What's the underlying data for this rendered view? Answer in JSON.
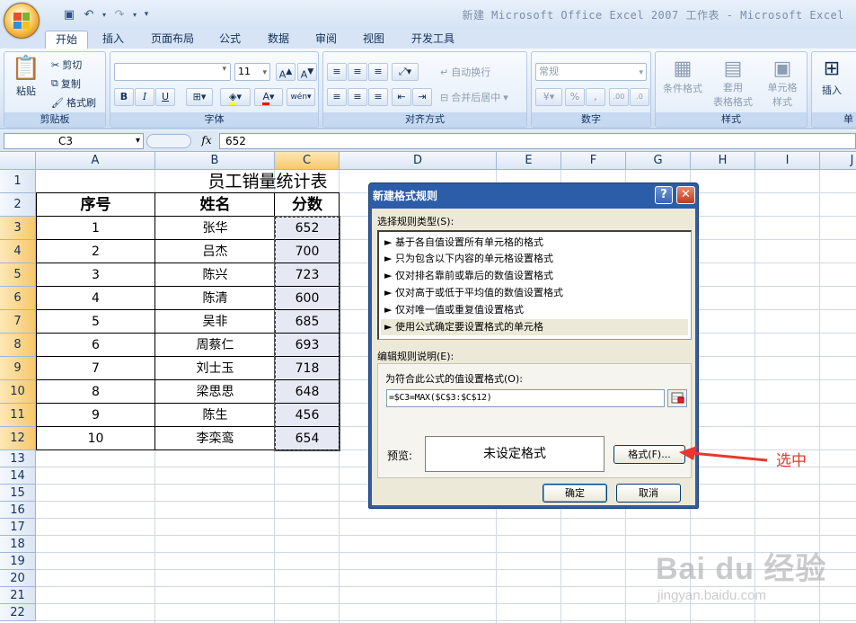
{
  "app": {
    "window_title": "新建 Microsoft Office Excel 2007 工作表 - Microsoft Excel",
    "tabs": [
      "开始",
      "插入",
      "页面布局",
      "公式",
      "数据",
      "审阅",
      "视图",
      "开发工具"
    ],
    "active_tab": "开始"
  },
  "ribbon": {
    "clipboard": {
      "paste": "粘贴",
      "cut": "剪切",
      "copy": "复制",
      "format_painter": "格式刷",
      "label": "剪贴板"
    },
    "font": {
      "size": "11",
      "bold": "B",
      "italic": "I",
      "underline": "U",
      "label": "字体"
    },
    "alignment": {
      "wrap": "自动换行",
      "merge": "合并后居中",
      "label": "对齐方式"
    },
    "number": {
      "format": "常规",
      "percent": "%",
      "comma": ",",
      "label": "数字"
    },
    "styles": {
      "conditional": "条件格式",
      "table_line1": "套用",
      "table_line2": "表格格式",
      "cell_line1": "单元格",
      "cell_line2": "样式",
      "label": "样式"
    },
    "cells": {
      "insert": "插入",
      "label": "单"
    }
  },
  "formula_bar": {
    "name_box": "C3",
    "fx": "fx",
    "value": "652"
  },
  "sheet": {
    "columns": [
      "A",
      "B",
      "C",
      "D",
      "E",
      "F",
      "G",
      "H",
      "I",
      "J"
    ],
    "rows": [
      "1",
      "2",
      "3",
      "4",
      "5",
      "6",
      "7",
      "8",
      "9",
      "10",
      "11",
      "12",
      "13",
      "14",
      "15",
      "16",
      "17",
      "18",
      "19",
      "20",
      "21",
      "22"
    ],
    "title": "员工销量统计表",
    "headers": [
      "序号",
      "姓名",
      "分数"
    ],
    "data": [
      [
        "1",
        "张华",
        "652"
      ],
      [
        "2",
        "吕杰",
        "700"
      ],
      [
        "3",
        "陈兴",
        "723"
      ],
      [
        "4",
        "陈清",
        "600"
      ],
      [
        "5",
        "吴非",
        "685"
      ],
      [
        "6",
        "周蔡仁",
        "693"
      ],
      [
        "7",
        "刘士玉",
        "718"
      ],
      [
        "8",
        "梁思思",
        "648"
      ],
      [
        "9",
        "陈生",
        "456"
      ],
      [
        "10",
        "李栾鸾",
        "654"
      ]
    ]
  },
  "dialog": {
    "title": "新建格式规则",
    "help": "?",
    "close": "✕",
    "select_rule_type": "选择规则类型(S):",
    "rule_types": [
      "► 基于各自值设置所有单元格的格式",
      "► 只为包含以下内容的单元格设置格式",
      "► 仅对排名靠前或靠后的数值设置格式",
      "► 仅对高于或低于平均值的数值设置格式",
      "► 仅对唯一值或重复值设置格式",
      "► 使用公式确定要设置格式的单元格"
    ],
    "edit_rule": "编辑规则说明(E):",
    "formula_label": "为符合此公式的值设置格式(O):",
    "formula": "=$C3=MAX($C$3:$C$12)",
    "preview_label": "预览:",
    "preview_text": "未设定格式",
    "format_button": "格式(F)...",
    "ok": "确定",
    "cancel": "取消"
  },
  "annotation": "选中",
  "watermark": {
    "brand": "Bai du 经验",
    "url": "jingyan.baidu.com"
  },
  "colors": {
    "accent_blue": "#2b5da8",
    "selected_header": "#f6c86c",
    "arrow_red": "#e8382d"
  }
}
